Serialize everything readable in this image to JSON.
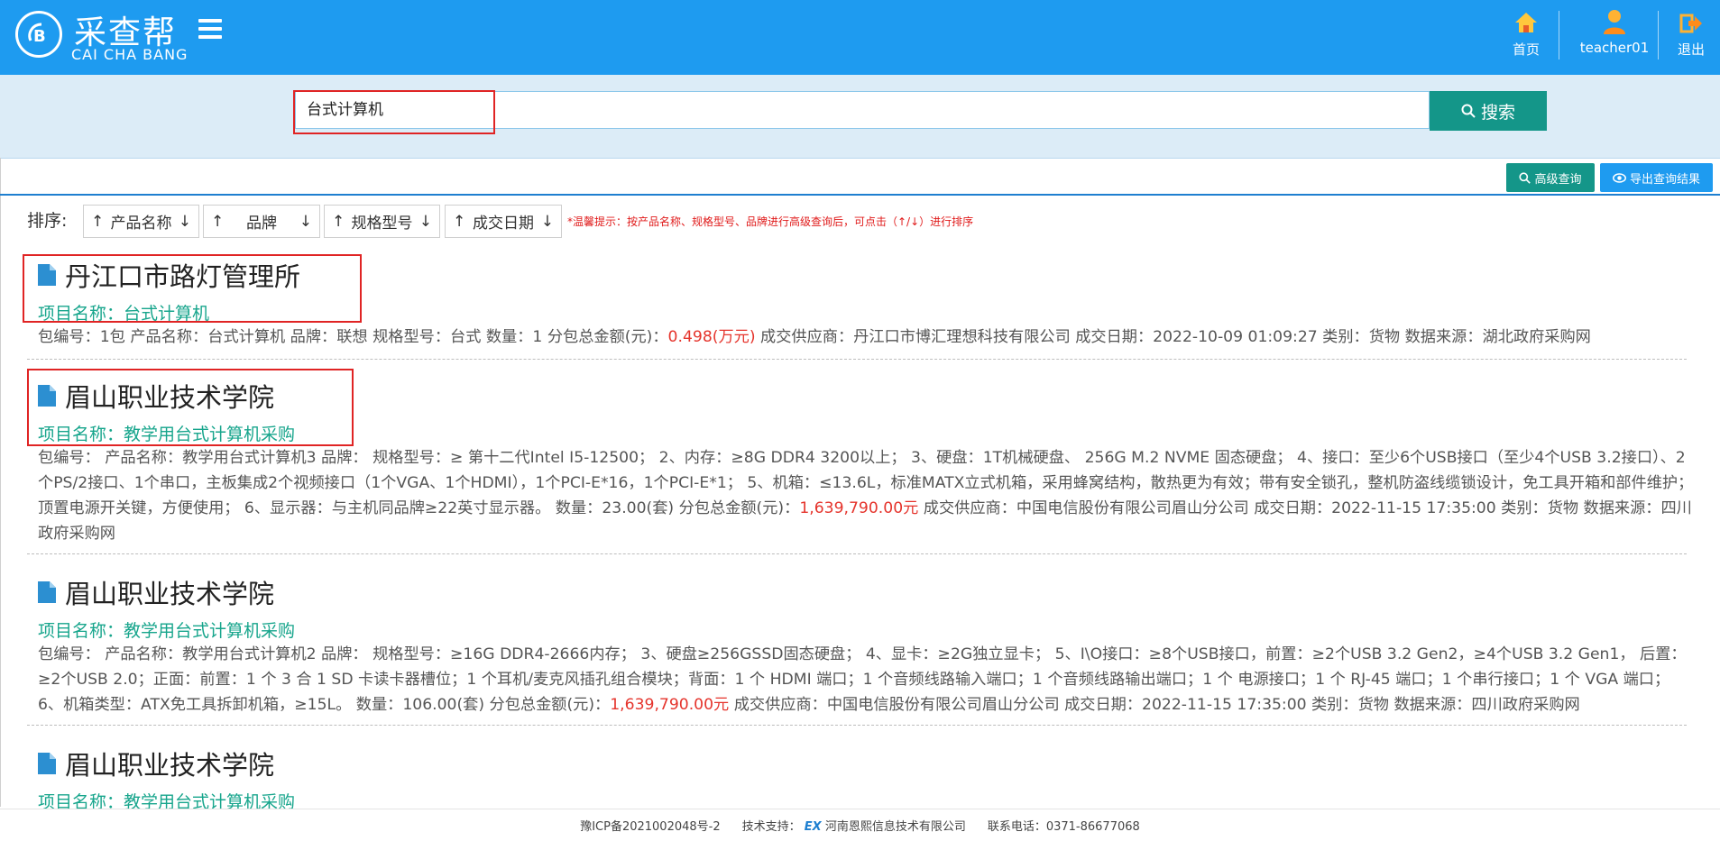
{
  "header": {
    "logo_cn": "采查帮",
    "logo_en": "CAI CHA BANG",
    "nav": [
      {
        "label": "首页",
        "icon": "home-icon"
      },
      {
        "label": "teacher01",
        "icon": "user-icon"
      },
      {
        "label": "退出",
        "icon": "logout-icon"
      }
    ],
    "colors": {
      "header_bg": "#1e9bf0",
      "search_button": "#149689",
      "amount": "#e5342c",
      "project": "#17a58c"
    }
  },
  "search": {
    "value": "台式计算机",
    "button_label": "搜索"
  },
  "actions": {
    "advanced_label": "高级查询",
    "export_label": "导出查询结果"
  },
  "sort": {
    "label": "排序:",
    "buttons": [
      "产品名称",
      "品牌",
      "规格型号",
      "成交日期"
    ],
    "hint": "*温馨提示：按产品名称、规格型号、品牌进行高级查询后，可点击（↑/↓）进行排序"
  },
  "results": [
    {
      "title": "丹江口市路灯管理所",
      "project": "项目名称：台式计算机",
      "details_before": "包编号：1包  产品名称：台式计算机  品牌：联想  规格型号：台式  数量：1  分包总金额(元)：",
      "amount": "0.498(万元)",
      "details_after": "  成交供应商：丹江口市博汇理想科技有限公司  成交日期：2022-10-09 01:09:27  类别：货物  数据来源：湖北政府采购网"
    },
    {
      "title": "眉山职业技术学院",
      "project": "项目名称：教学用台式计算机采购",
      "details_before": "包编号：  产品名称：教学用台式计算机3  品牌：  规格型号：≥ 第十二代Intel I5-12500；  2、内存：≥8G DDR4 3200以上；  3、硬盘：1T机械硬盘、  256G M.2 NVME 固态硬盘；  4、接口：至少6个USB接口（至少4个USB 3.2接口）、2个PS/2接口、1个串口，主板集成2个视频接口（1个VGA、1个HDMI），1个PCI-E*16，1个PCI-E*1；  5、机箱：≤13.6L，标准MATX立式机箱，采用蜂窝结构，散热更为有效；带有安全锁孔，整机防盗线缆锁设计，免工具开箱和部件维护；顶置电源开关键，方便使用；  6、显示器：与主机同品牌≥22英寸显示器。  数量：23.00(套)  分包总金额(元)：",
      "amount": "1,639,790.00元",
      "details_after": "  成交供应商：中国电信股份有限公司眉山分公司  成交日期：2022-11-15 17:35:00  类别：货物  数据来源：四川政府采购网"
    },
    {
      "title": "眉山职业技术学院",
      "project": "项目名称：教学用台式计算机采购",
      "details_before": "包编号：  产品名称：教学用台式计算机2  品牌：  规格型号：≥16G DDR4-2666内存；  3、硬盘≥256GSSD固态硬盘；  4、显卡：≥2G独立显卡；  5、I\\O接口：≥8个USB接口，前置：≥2个USB 3.2 Gen2，≥4个USB 3.2 Gen1，  后置：≥2个USB 2.0；正面：前置：1 个 3 合 1 SD 卡读卡器槽位；1 个耳机/麦克风插孔组合模块；背面：1 个 HDMI 端口；1 个音频线路输入端口；1 个音频线路输出端口；1 个 电源接口；1 个 RJ-45 端口；1 个串行接口；1 个 VGA 端口；  6、机箱类型：ATX免工具拆卸机箱，≥15L。  数量：106.00(套)  分包总金额(元)：",
      "amount": "1,639,790.00元",
      "details_after": "  成交供应商：中国电信股份有限公司眉山分公司  成交日期：2022-11-15 17:35:00  类别：货物  数据来源：四川政府采购网"
    },
    {
      "title": "眉山职业技术学院",
      "project": "项目名称：教学用台式计算机采购",
      "details_before": "",
      "amount": "",
      "details_after": ""
    }
  ],
  "footer": {
    "icp": "豫ICP备2021002048号-2",
    "support_label": "技术支持：",
    "support_logo": "EX",
    "support_company": "河南恩熙信息技术有限公司",
    "phone": "联系电话：0371-86677068"
  }
}
